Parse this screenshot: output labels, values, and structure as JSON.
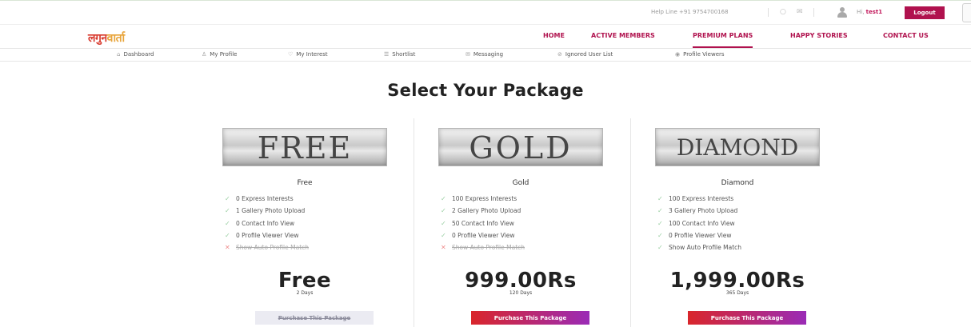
{
  "header": {
    "helpline": "Help Line +91 9754700168",
    "greeting_prefix": "Hi,",
    "username": "test1",
    "logout_label": "Logout"
  },
  "logo": {
    "part1": "लगुन",
    "part2": "वार्ता"
  },
  "nav": {
    "items": [
      {
        "label": "HOME"
      },
      {
        "label": "ACTIVE MEMBERS"
      },
      {
        "label": "PREMIUM PLANS",
        "active": true
      },
      {
        "label": "HAPPY STORIES"
      },
      {
        "label": "CONTACT US"
      }
    ]
  },
  "submenu": {
    "items": [
      {
        "label": "Dashboard",
        "icon": "home-icon",
        "glyph": "⌂"
      },
      {
        "label": "My Profile",
        "icon": "user-icon",
        "glyph": "♙"
      },
      {
        "label": "My Interest",
        "icon": "heart-icon",
        "glyph": "♡"
      },
      {
        "label": "Shortlist",
        "icon": "list-icon",
        "glyph": "☰"
      },
      {
        "label": "Messaging",
        "icon": "mail-icon",
        "glyph": "✉"
      },
      {
        "label": "Ignored User List",
        "icon": "block-icon",
        "glyph": "⊘"
      },
      {
        "label": "Profile Viewers",
        "icon": "eye-icon",
        "glyph": "◉"
      }
    ]
  },
  "page": {
    "title": "Select Your Package"
  },
  "packages": [
    {
      "banner": "FREE",
      "name": "Free",
      "features": [
        {
          "text": "0 Express Interests",
          "included": true
        },
        {
          "text": "1 Gallery Photo Upload",
          "included": true
        },
        {
          "text": "0 Contact Info View",
          "included": true
        },
        {
          "text": "0 Profile Viewer View",
          "included": true
        },
        {
          "text": "Show Auto Profile Match",
          "included": false
        }
      ],
      "price": "Free",
      "duration": "2 Days",
      "button_label": "Purchase This Package",
      "button_enabled": false
    },
    {
      "banner": "GOLD",
      "name": "Gold",
      "features": [
        {
          "text": "100 Express Interests",
          "included": true
        },
        {
          "text": "2 Gallery Photo Upload",
          "included": true
        },
        {
          "text": "50 Contact Info View",
          "included": true
        },
        {
          "text": "0 Profile Viewer View",
          "included": true
        },
        {
          "text": "Show Auto Profile Match",
          "included": false
        }
      ],
      "price": "999.00Rs",
      "duration": "120 Days",
      "button_label": "Purchase This Package",
      "button_enabled": true
    },
    {
      "banner": "DIAMOND",
      "name": "Diamond",
      "features": [
        {
          "text": "100 Express Interests",
          "included": true
        },
        {
          "text": "3 Gallery Photo Upload",
          "included": true
        },
        {
          "text": "100 Contact Info View",
          "included": true
        },
        {
          "text": "0 Profile Viewer View",
          "included": true
        },
        {
          "text": "Show Auto Profile Match",
          "included": true
        }
      ],
      "price": "1,999.00Rs",
      "duration": "365 Days",
      "button_label": "Purchase This Package",
      "button_enabled": true
    }
  ],
  "colors": {
    "brand": "#b0124e",
    "button_start": "#d9262b",
    "button_end": "#9a2bb6",
    "check": "#9acfa2",
    "cross": "#ef8c8c"
  }
}
